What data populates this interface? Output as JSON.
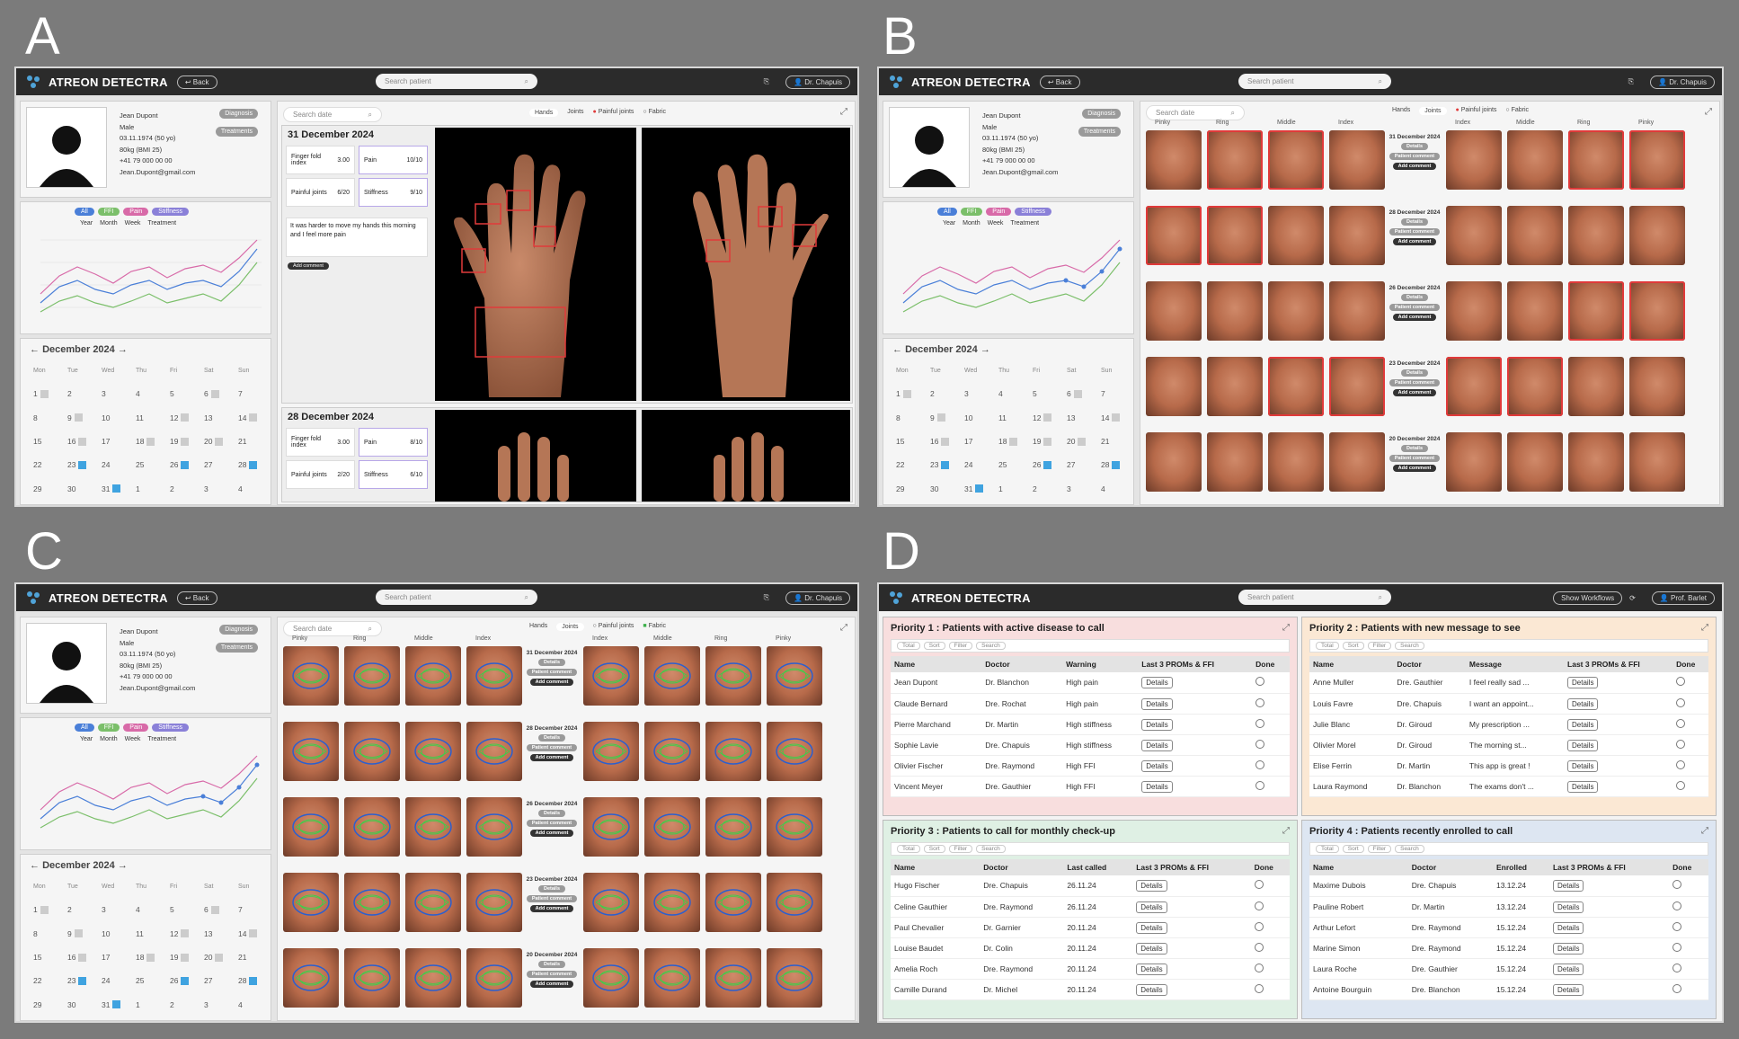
{
  "labels": {
    "a": "A",
    "b": "B",
    "c": "C",
    "d": "D"
  },
  "app": {
    "brand": "ATREON DETECTRA",
    "back": "Back",
    "search_patient": "Search patient",
    "search_date": "Search date",
    "doctor": "Dr. Chapuis"
  },
  "patient": {
    "name": "Jean Dupont",
    "sex": "Male",
    "dob": "03.11.1974 (50 yo)",
    "weight": "80kg (BMI 25)",
    "phone": "+41 79 000 00 00",
    "email": "Jean.Dupont@gmail.com",
    "diagnosis": "Diagnosis",
    "treatments": "Treatments"
  },
  "chart": {
    "chips": [
      "All",
      "FFI",
      "Pain",
      "Stiffness"
    ],
    "ranges": [
      "Year",
      "Month",
      "Week",
      "Treatment"
    ],
    "chip_colors": [
      "#4a7fd8",
      "#7bbf6a",
      "#d86aa8",
      "#8a80d8"
    ]
  },
  "calendar": {
    "title": "December 2024",
    "weekdays": [
      "Mon",
      "Tue",
      "Wed",
      "Thu",
      "Fri",
      "Sat",
      "Sun"
    ]
  },
  "panel_a": {
    "toggles": [
      "Hands",
      "Joints",
      "Painful joints",
      "Fabric"
    ],
    "entry1": {
      "date": "31 December 2024",
      "fingerfold_label": "Finger fold index",
      "fingerfold": "3.00",
      "pain_label": "Pain",
      "pain": "10/10",
      "painful_label": "Painful joints",
      "painful": "6/20",
      "stiff_label": "Stiffness",
      "stiff": "9/10",
      "comment": "It was harder to move my hands this morning and I feel more pain",
      "add_comment": "Add comment"
    },
    "entry2": {
      "date": "28 December 2024",
      "fingerfold_label": "Finger fold index",
      "fingerfold": "3.00",
      "pain_label": "Pain",
      "pain": "8/10",
      "painful_label": "Painful joints",
      "painful": "2/20",
      "stiff_label": "Stiffness",
      "stiff": "6/10"
    }
  },
  "panel_b": {
    "toggles": [
      "Hands",
      "Joints",
      "Painful joints",
      "Fabric"
    ],
    "cols": [
      "Pinky",
      "Ring",
      "Middle",
      "Index",
      "Index",
      "Middle",
      "Ring",
      "Pinky"
    ],
    "dates": [
      "31 December 2024",
      "28 December 2024",
      "26 December 2024",
      "23 December 2024",
      "20 December 2024"
    ],
    "details": "Details",
    "patient_comment": "Patient comment",
    "add_comment": "Add comment"
  },
  "panel_d": {
    "brand": "ATREON DETECTRA",
    "search": "Search patient",
    "workflow": "Show Workflows",
    "doctor": "Prof. Barlet",
    "tools": [
      "Total",
      "Sort",
      "Filter",
      "Search"
    ],
    "p1": {
      "title": "Priority 1 : Patients with active disease to call",
      "cols": [
        "Name",
        "Doctor",
        "Warning",
        "Last 3 PROMs & FFI",
        "Done"
      ],
      "rows": [
        [
          "Jean Dupont",
          "Dr. Blanchon",
          "High pain"
        ],
        [
          "Claude Bernard",
          "Dre. Rochat",
          "High pain"
        ],
        [
          "Pierre Marchand",
          "Dr. Martin",
          "High stiffness"
        ],
        [
          "Sophie Lavie",
          "Dre. Chapuis",
          "High stiffness"
        ],
        [
          "Olivier Fischer",
          "Dre. Raymond",
          "High FFI"
        ],
        [
          "Vincent Meyer",
          "Dre. Gauthier",
          "High FFI"
        ]
      ]
    },
    "p2": {
      "title": "Priority 2 : Patients with new message to see",
      "cols": [
        "Name",
        "Doctor",
        "Message",
        "Last 3 PROMs & FFI",
        "Done"
      ],
      "rows": [
        [
          "Anne Muller",
          "Dre. Gauthier",
          "I feel really sad ..."
        ],
        [
          "Louis Favre",
          "Dre. Chapuis",
          "I want an appoint..."
        ],
        [
          "Julie Blanc",
          "Dr. Giroud",
          "My prescription ..."
        ],
        [
          "Olivier Morel",
          "Dr. Giroud",
          "The morning st..."
        ],
        [
          "Elise Ferrin",
          "Dr. Martin",
          "This app is great !"
        ],
        [
          "Laura Raymond",
          "Dr. Blanchon",
          "The exams don't ..."
        ]
      ]
    },
    "p3": {
      "title": "Priority 3 : Patients to call for monthly check-up",
      "cols": [
        "Name",
        "Doctor",
        "Last called",
        "Last 3 PROMs & FFI",
        "Done"
      ],
      "rows": [
        [
          "Hugo Fischer",
          "Dre. Chapuis",
          "26.11.24"
        ],
        [
          "Celine Gauthier",
          "Dre. Raymond",
          "26.11.24"
        ],
        [
          "Paul Chevalier",
          "Dr. Garnier",
          "20.11.24"
        ],
        [
          "Louise Baudet",
          "Dr. Colin",
          "20.11.24"
        ],
        [
          "Amelia Roch",
          "Dre. Raymond",
          "20.11.24"
        ],
        [
          "Camille Durand",
          "Dr. Michel",
          "20.11.24"
        ]
      ]
    },
    "p4": {
      "title": "Priority 4 : Patients recently enrolled to call",
      "cols": [
        "Name",
        "Doctor",
        "Enrolled",
        "Last 3 PROMs & FFI",
        "Done"
      ],
      "rows": [
        [
          "Maxime Dubois",
          "Dre. Chapuis",
          "13.12.24"
        ],
        [
          "Pauline Robert",
          "Dr. Martin",
          "13.12.24"
        ],
        [
          "Arthur Lefort",
          "Dre. Raymond",
          "15.12.24"
        ],
        [
          "Marine Simon",
          "Dre. Raymond",
          "15.12.24"
        ],
        [
          "Laura Roche",
          "Dre. Gauthier",
          "15.12.24"
        ],
        [
          "Antoine Bourguin",
          "Dre. Blanchon",
          "15.12.24"
        ]
      ]
    },
    "details": "Details"
  }
}
